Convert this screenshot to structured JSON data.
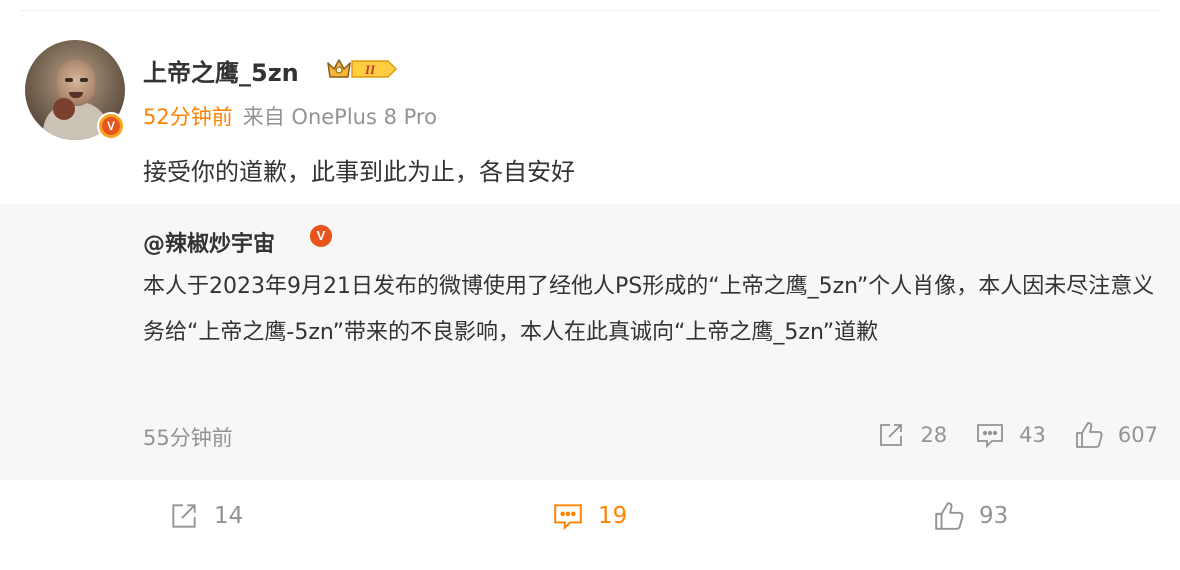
{
  "post": {
    "username": "上帝之鹰_5zn",
    "level_badge": "II",
    "time": "52分钟前",
    "source": "来自 OnePlus 8 Pro",
    "content": "接受你的道歉，此事到此为止，各自安好",
    "verified_icon": "v-badge-icon",
    "verified_label": "V",
    "accent_color": "#ff8200"
  },
  "repost": {
    "username": "@辣椒炒宇宙",
    "verified_label": "V",
    "text": "本人于2023年9月21日发布的微博使用了经他人PS形成的“上帝之鹰_5zn”个人肖像，本人因未尽注意义务给“上帝之鹰-5zn”带来的不良影响，本人在此真诚向“上帝之鹰_5zn”道歉",
    "time": "55分钟前",
    "share_count": "28",
    "comment_count": "43",
    "like_count": "607"
  },
  "actions": {
    "share_count": "14",
    "comment_count": "19",
    "like_count": "93"
  }
}
